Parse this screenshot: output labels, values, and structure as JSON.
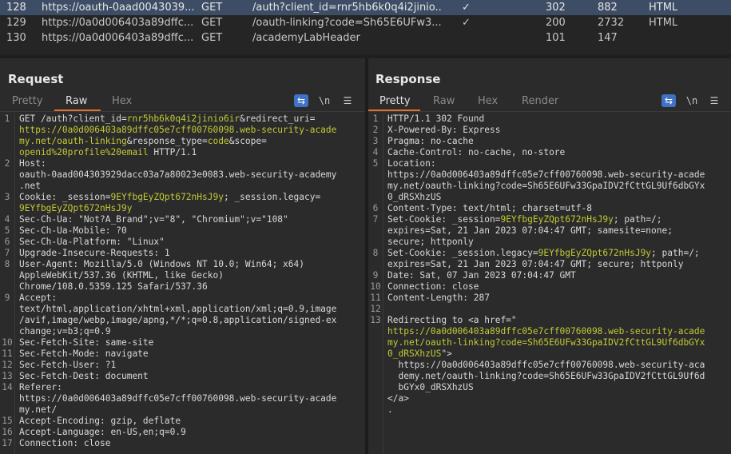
{
  "history": [
    {
      "num": "128",
      "host": "https://oauth-0aad0043039...",
      "method": "GET",
      "url": "/auth?client_id=rnr5hb6k0q4i2jinio...",
      "edited": "✓",
      "status": "302",
      "length": "882",
      "mime": "HTML",
      "selected": true
    },
    {
      "num": "129",
      "host": "https://0a0d006403a89dffc...",
      "method": "GET",
      "url": "/oauth-linking?code=Sh65E6UFw3...",
      "edited": "✓",
      "status": "200",
      "length": "2732",
      "mime": "HTML",
      "selected": false
    },
    {
      "num": "130",
      "host": "https://0a0d006403a89dffc...",
      "method": "GET",
      "url": "/academyLabHeader",
      "edited": "",
      "status": "101",
      "length": "147",
      "mime": "",
      "selected": false
    }
  ],
  "request": {
    "title": "Request",
    "tabs": [
      "Pretty",
      "Raw",
      "Hex"
    ],
    "active_tab": "Raw",
    "tools": {
      "wrap": "⇆",
      "newline": "\\n",
      "menu": "☰"
    },
    "lines": [
      {
        "n": "1",
        "segs": [
          [
            "k",
            "GET /auth?client_id="
          ],
          [
            "y",
            "rnr5hb6k0q4i2jinio6ir"
          ],
          [
            "k",
            "&redirect_uri="
          ]
        ]
      },
      {
        "n": "",
        "segs": [
          [
            "y",
            "https://0a0d006403a89dffc05e7cff00760098.web-security-acade"
          ]
        ]
      },
      {
        "n": "",
        "segs": [
          [
            "y",
            "my.net/oauth-linking"
          ],
          [
            "k",
            "&response_type="
          ],
          [
            "y",
            "code"
          ],
          [
            "k",
            "&scope="
          ]
        ]
      },
      {
        "n": "",
        "segs": [
          [
            "y",
            "openid%20profile%20email"
          ],
          [
            "k",
            " HTTP/1.1"
          ]
        ]
      },
      {
        "n": "2",
        "segs": [
          [
            "k",
            "Host:"
          ]
        ]
      },
      {
        "n": "",
        "segs": [
          [
            "v",
            "oauth-0aad004303929dacc03a7a80023e0083.web-security-academy"
          ]
        ]
      },
      {
        "n": "",
        "segs": [
          [
            "v",
            ".net"
          ]
        ]
      },
      {
        "n": "3",
        "segs": [
          [
            "k",
            "Cookie: _session="
          ],
          [
            "y",
            "9EYfbgEyZQpt672nHsJ9y"
          ],
          [
            "k",
            "; _session.legacy="
          ]
        ]
      },
      {
        "n": "",
        "segs": [
          [
            "y",
            "9EYfbgEyZQpt672nHsJ9y"
          ]
        ]
      },
      {
        "n": "4",
        "segs": [
          [
            "k",
            "Sec-Ch-Ua: \"Not?A_Brand\";v=\"8\", \"Chromium\";v=\"108\""
          ]
        ]
      },
      {
        "n": "5",
        "segs": [
          [
            "k",
            "Sec-Ch-Ua-Mobile: ?0"
          ]
        ]
      },
      {
        "n": "6",
        "segs": [
          [
            "k",
            "Sec-Ch-Ua-Platform: \"Linux\""
          ]
        ]
      },
      {
        "n": "7",
        "segs": [
          [
            "k",
            "Upgrade-Insecure-Requests: 1"
          ]
        ]
      },
      {
        "n": "8",
        "segs": [
          [
            "k",
            "User-Agent: Mozilla/5.0 (Windows NT 10.0; Win64; x64)"
          ]
        ]
      },
      {
        "n": "",
        "segs": [
          [
            "v",
            "AppleWebKit/537.36 (KHTML, like Gecko)"
          ]
        ]
      },
      {
        "n": "",
        "segs": [
          [
            "v",
            "Chrome/108.0.5359.125 Safari/537.36"
          ]
        ]
      },
      {
        "n": "9",
        "segs": [
          [
            "k",
            "Accept:"
          ]
        ]
      },
      {
        "n": "",
        "segs": [
          [
            "v",
            "text/html,application/xhtml+xml,application/xml;q=0.9,image"
          ]
        ]
      },
      {
        "n": "",
        "segs": [
          [
            "v",
            "/avif,image/webp,image/apng,*/*;q=0.8,application/signed-ex"
          ]
        ]
      },
      {
        "n": "",
        "segs": [
          [
            "v",
            "change;v=b3;q=0.9"
          ]
        ]
      },
      {
        "n": "10",
        "segs": [
          [
            "k",
            "Sec-Fetch-Site: same-site"
          ]
        ]
      },
      {
        "n": "11",
        "segs": [
          [
            "k",
            "Sec-Fetch-Mode: navigate"
          ]
        ]
      },
      {
        "n": "12",
        "segs": [
          [
            "k",
            "Sec-Fetch-User: ?1"
          ]
        ]
      },
      {
        "n": "13",
        "segs": [
          [
            "k",
            "Sec-Fetch-Dest: document"
          ]
        ]
      },
      {
        "n": "14",
        "segs": [
          [
            "k",
            "Referer:"
          ]
        ]
      },
      {
        "n": "",
        "segs": [
          [
            "v",
            "https://0a0d006403a89dffc05e7cff00760098.web-security-acade"
          ]
        ]
      },
      {
        "n": "",
        "segs": [
          [
            "v",
            "my.net/"
          ]
        ]
      },
      {
        "n": "15",
        "segs": [
          [
            "k",
            "Accept-Encoding: gzip, deflate"
          ]
        ]
      },
      {
        "n": "16",
        "segs": [
          [
            "k",
            "Accept-Language: en-US,en;q=0.9"
          ]
        ]
      },
      {
        "n": "17",
        "segs": [
          [
            "k",
            "Connection: close"
          ]
        ]
      }
    ]
  },
  "response": {
    "title": "Response",
    "tabs": [
      "Pretty",
      "Raw",
      "Hex",
      "Render"
    ],
    "active_tab": "Pretty",
    "tools": {
      "wrap": "⇆",
      "newline": "\\n",
      "menu": "☰"
    },
    "lines": [
      {
        "n": "1",
        "segs": [
          [
            "k",
            "HTTP/1.1 302 Found"
          ]
        ]
      },
      {
        "n": "2",
        "segs": [
          [
            "k",
            "X-Powered-By: Express"
          ]
        ]
      },
      {
        "n": "3",
        "segs": [
          [
            "k",
            "Pragma: no-cache"
          ]
        ]
      },
      {
        "n": "4",
        "segs": [
          [
            "k",
            "Cache-Control: no-cache, no-store"
          ]
        ]
      },
      {
        "n": "5",
        "segs": [
          [
            "k",
            "Location:"
          ]
        ]
      },
      {
        "n": "",
        "segs": [
          [
            "v",
            "https://0a0d006403a89dffc05e7cff00760098.web-security-acade"
          ]
        ]
      },
      {
        "n": "",
        "segs": [
          [
            "v",
            "my.net/oauth-linking?code=Sh65E6UFw33GpaIDV2fCttGL9Uf6dbGYx"
          ]
        ]
      },
      {
        "n": "",
        "segs": [
          [
            "v",
            "0_dRSXhzUS"
          ]
        ]
      },
      {
        "n": "6",
        "segs": [
          [
            "k",
            "Content-Type: text/html; charset=utf-8"
          ]
        ]
      },
      {
        "n": "7",
        "segs": [
          [
            "k",
            "Set-Cookie: _session="
          ],
          [
            "y",
            "9EYfbgEyZQpt672nHsJ9y"
          ],
          [
            "k",
            "; path=/;"
          ]
        ]
      },
      {
        "n": "",
        "segs": [
          [
            "v",
            "expires=Sat, 21 Jan 2023 07:04:47 GMT; samesite=none;"
          ]
        ]
      },
      {
        "n": "",
        "segs": [
          [
            "v",
            "secure; httponly"
          ]
        ]
      },
      {
        "n": "8",
        "segs": [
          [
            "k",
            "Set-Cookie: _session.legacy="
          ],
          [
            "y",
            "9EYfbgEyZQpt672nHsJ9y"
          ],
          [
            "k",
            "; path=/;"
          ]
        ]
      },
      {
        "n": "",
        "segs": [
          [
            "v",
            "expires=Sat, 21 Jan 2023 07:04:47 GMT; secure; httponly"
          ]
        ]
      },
      {
        "n": "9",
        "segs": [
          [
            "k",
            "Date: Sat, 07 Jan 2023 07:04:47 GMT"
          ]
        ]
      },
      {
        "n": "10",
        "segs": [
          [
            "k",
            "Connection: close"
          ]
        ]
      },
      {
        "n": "11",
        "segs": [
          [
            "k",
            "Content-Length: 287"
          ]
        ]
      },
      {
        "n": "12",
        "segs": [
          [
            "k",
            ""
          ]
        ]
      },
      {
        "n": "13",
        "segs": [
          [
            "k",
            "Redirecting to <a href=\""
          ]
        ]
      },
      {
        "n": "",
        "segs": [
          [
            "y",
            "https://0a0d006403a89dffc05e7cff00760098.web-security-acade"
          ]
        ]
      },
      {
        "n": "",
        "segs": [
          [
            "y",
            "my.net/oauth-linking?code=Sh65E6UFw33GpaIDV2fCttGL9Uf6dbGYx"
          ]
        ]
      },
      {
        "n": "",
        "segs": [
          [
            "y",
            "0_dRSXhzUS"
          ],
          [
            "k",
            "\">"
          ]
        ]
      },
      {
        "n": "",
        "segs": [
          [
            "v",
            "  https://0a0d006403a89dffc05e7cff00760098.web-security-aca"
          ]
        ]
      },
      {
        "n": "",
        "segs": [
          [
            "v",
            "  demy.net/oauth-linking?code=Sh65E6UFw33GpaIDV2fCttGL9Uf6d"
          ]
        ]
      },
      {
        "n": "",
        "segs": [
          [
            "v",
            "  bGYx0_dRSXhzUS"
          ]
        ]
      },
      {
        "n": "",
        "segs": [
          [
            "k",
            "</a>"
          ]
        ]
      },
      {
        "n": "",
        "segs": [
          [
            "k",
            "."
          ]
        ]
      }
    ]
  },
  "colors": {
    "accent": "#e4712e",
    "selected_row": "#3d4d66",
    "highlight": "#c3c935",
    "button_blue": "#3f72c4"
  }
}
